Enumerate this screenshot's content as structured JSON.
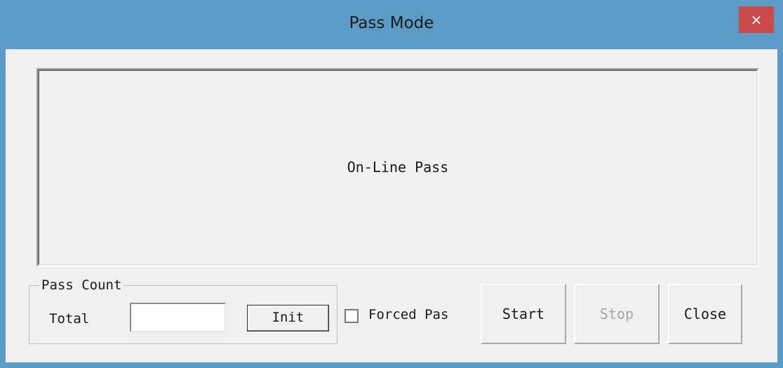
{
  "window": {
    "title": "Pass Mode",
    "close_glyph": "×"
  },
  "status": {
    "text": "On-Line Pass"
  },
  "pass_count": {
    "group_title": "Pass Count",
    "total_label": "Total",
    "total_value": "",
    "init_label": "Init"
  },
  "options": {
    "forced_pass_label": "Forced Pas",
    "forced_pass_checked": false
  },
  "buttons": {
    "start_label": "Start",
    "stop_label": "Stop",
    "close_label": "Close"
  },
  "colors": {
    "titlebar": "#5b9bc5",
    "close_button": "#c94b4b",
    "client": "#f0f0f0",
    "disabled_text": "#a7a7a7"
  }
}
